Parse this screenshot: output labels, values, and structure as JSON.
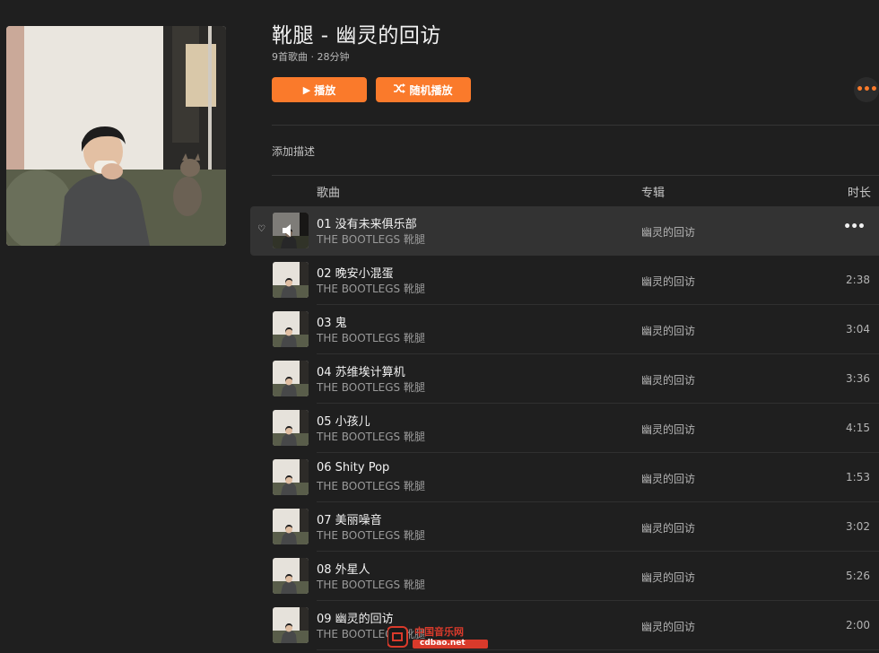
{
  "album": {
    "title": "靴腿 - 幽灵的回访",
    "meta": "9首歌曲 · 28分钟",
    "play_label": "播放",
    "shuffle_label": "随机播放",
    "play_icon": "play-icon",
    "shuffle_icon": "shuffle-icon",
    "more_icon": "more-horizontal-icon",
    "add_description": "添加描述"
  },
  "columns": {
    "song": "歌曲",
    "album": "专辑",
    "duration": "时长"
  },
  "tracks": [
    {
      "name": "01 没有未来俱乐部",
      "artist": "THE BOOTLEGS 靴腿",
      "album": "幽灵的回访",
      "duration": "",
      "playing": true
    },
    {
      "name": "02 晚安小混蛋",
      "artist": "THE BOOTLEGS 靴腿",
      "album": "幽灵的回访",
      "duration": "2:38"
    },
    {
      "name": "03 鬼",
      "artist": "THE BOOTLEGS 靴腿",
      "album": "幽灵的回访",
      "duration": "3:04"
    },
    {
      "name": "04 苏维埃计算机",
      "artist": "THE BOOTLEGS 靴腿",
      "album": "幽灵的回访",
      "duration": "3:36"
    },
    {
      "name": "05 小孩儿",
      "artist": "THE BOOTLEGS 靴腿",
      "album": "幽灵的回访",
      "duration": "4:15"
    },
    {
      "name": "06 Shity Pop",
      "artist": "THE BOOTLEGS 靴腿",
      "album": "幽灵的回访",
      "duration": "1:53"
    },
    {
      "name": "07 美丽噪音",
      "artist": "THE BOOTLEGS 靴腿",
      "album": "幽灵的回访",
      "duration": "3:02"
    },
    {
      "name": "08 外星人",
      "artist": "THE BOOTLEGS 靴腿",
      "album": "幽灵的回访",
      "duration": "5:26"
    },
    {
      "name": "09 幽灵的回访",
      "artist": "THE BOOTLEGS 靴腿",
      "album": "幽灵的回访",
      "duration": "2:00"
    }
  ],
  "watermark": {
    "top": "中国音乐网",
    "bottom": "cdbao.net"
  },
  "colors": {
    "accent": "#fa7a2b",
    "background": "#1f1f1f",
    "active_row": "#333333"
  }
}
